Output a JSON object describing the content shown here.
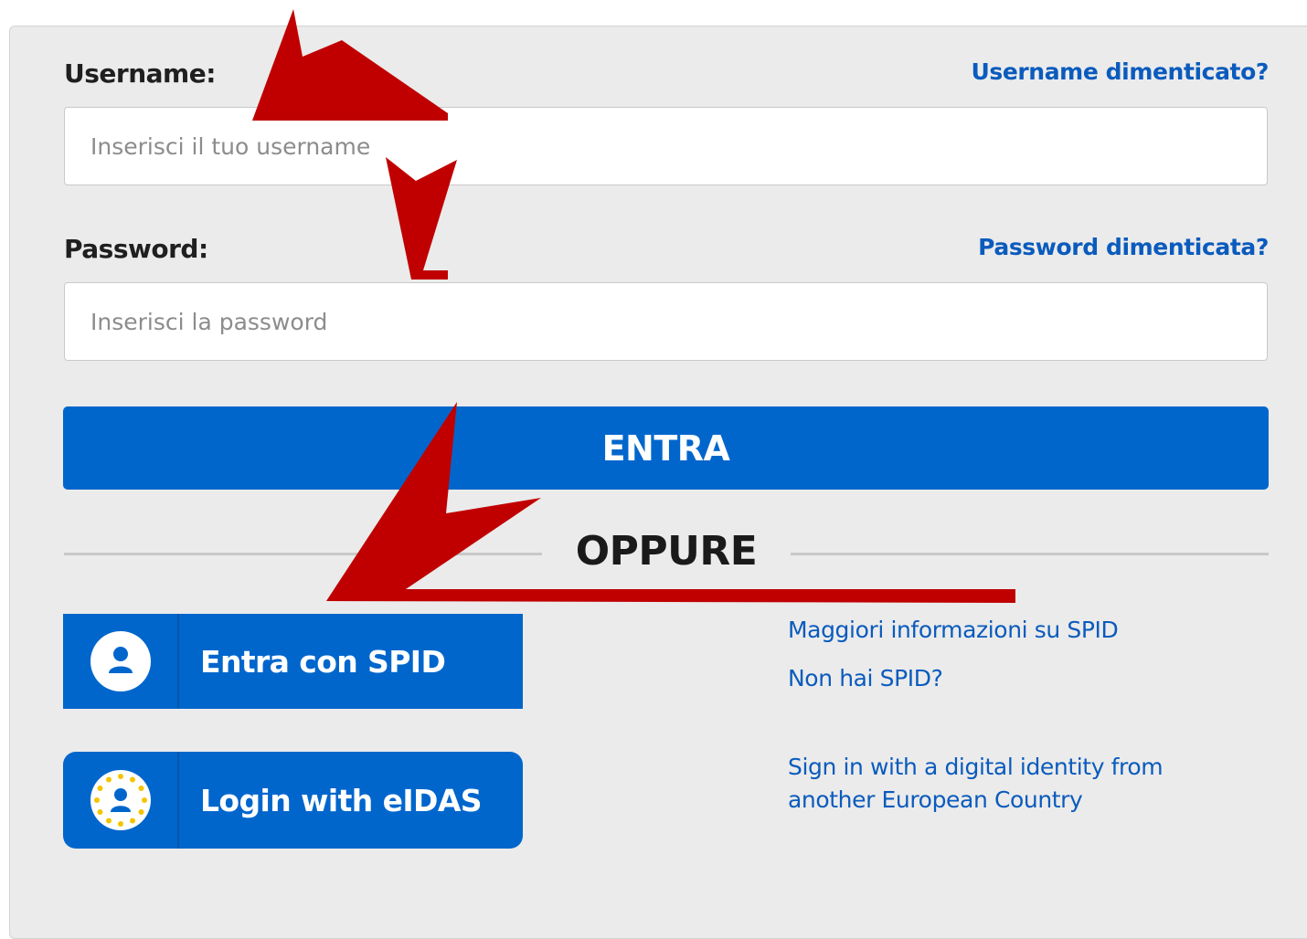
{
  "login": {
    "username_label": "Username:",
    "username_forgot": "Username dimenticato?",
    "username_placeholder": "Inserisci il tuo username",
    "password_label": "Password:",
    "password_forgot": "Password dimenticata?",
    "password_placeholder": "Inserisci la password",
    "submit_label": "ENTRA",
    "separator_text": "OPPURE"
  },
  "alternatives": {
    "spid": {
      "button_label": "Entra con SPID",
      "icon": "user-icon",
      "link_more_info": "Maggiori informazioni su SPID",
      "link_no_spid": "Non hai SPID?"
    },
    "eidas": {
      "button_label": "Login with eIDAS",
      "icon": "eu-stars-user-icon",
      "link_text": "Sign in with a digital identity from another European Country"
    }
  },
  "colors": {
    "primary": "#0066cc",
    "link": "#0a5bbd",
    "panel_bg": "#ebebeb",
    "annotation_arrow": "#c00000"
  }
}
